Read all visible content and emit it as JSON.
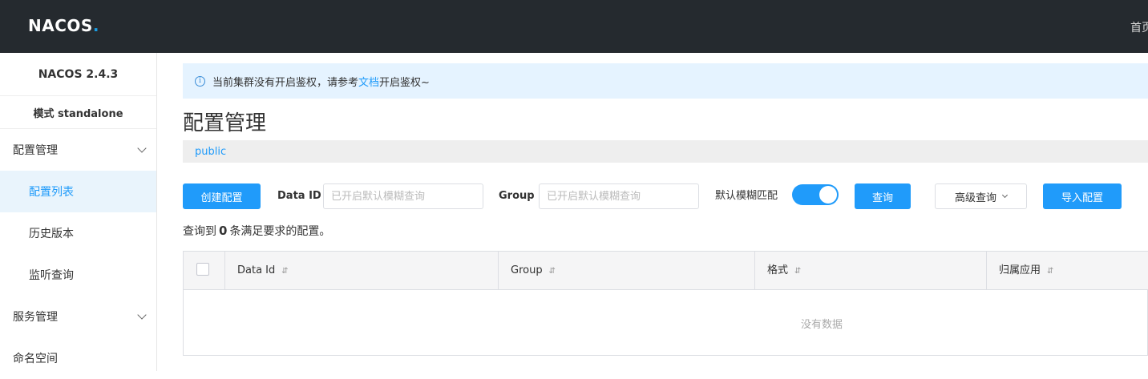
{
  "header": {
    "logo_text": "NACOS",
    "logo_dot": ".",
    "top_link": "首页"
  },
  "sidebar": {
    "version": "NACOS 2.4.3",
    "mode": "模式 standalone",
    "groups": [
      {
        "label": "配置管理",
        "items": [
          "配置列表",
          "历史版本",
          "监听查询"
        ],
        "active_item": "配置列表"
      },
      {
        "label": "服务管理"
      },
      {
        "label": "命名空间"
      }
    ]
  },
  "notice": {
    "prefix": "当前集群没有开启鉴权，请参考",
    "link": "文档",
    "suffix": "开启鉴权~"
  },
  "page": {
    "title": "配置管理",
    "namespace": "public"
  },
  "filters": {
    "create_button": "创建配置",
    "data_id_label": "Data ID",
    "data_id_placeholder": "已开启默认模糊查询",
    "group_label": "Group",
    "group_placeholder": "已开启默认模糊查询",
    "fuzzy_label": "默认模糊匹配",
    "fuzzy_enabled": true,
    "query_button": "查询",
    "advanced_button": "高级查询",
    "import_button": "导入配置"
  },
  "result": {
    "prefix": "查询到",
    "count": "0",
    "suffix": "条满足要求的配置。"
  },
  "table": {
    "columns": [
      "Data Id",
      "Group",
      "格式",
      "归属应用"
    ],
    "empty_text": "没有数据"
  },
  "colors": {
    "primary": "#209bfa",
    "topbar": "#252a2f",
    "notice_bg": "#e5f3ff"
  }
}
